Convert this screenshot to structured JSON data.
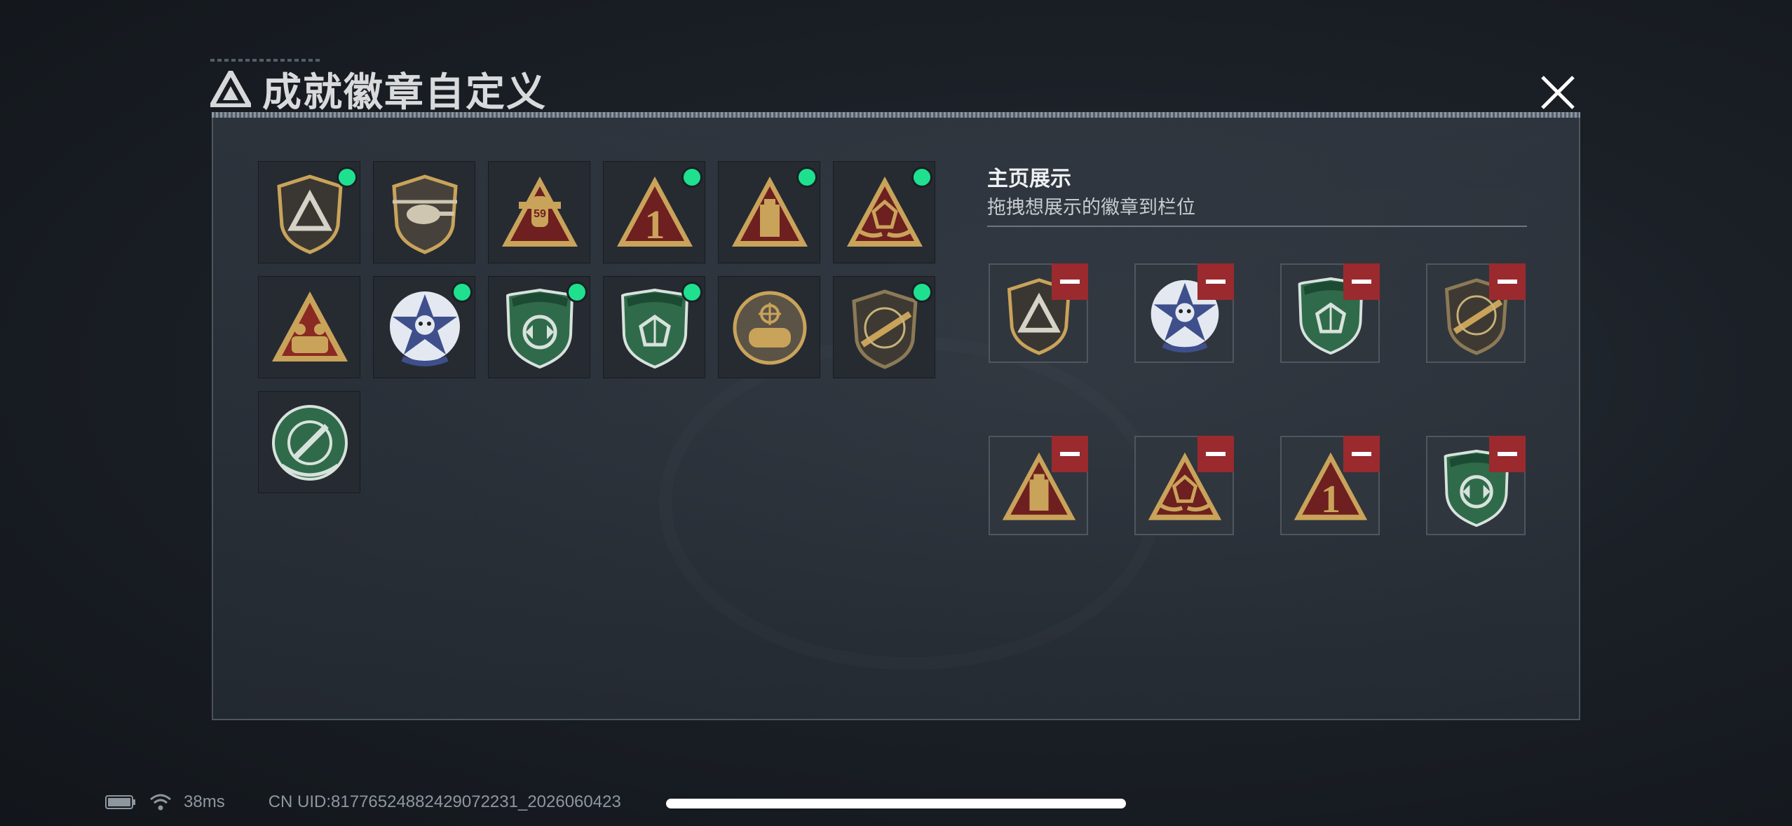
{
  "header": {
    "title": "成就徽章自定义"
  },
  "side": {
    "title": "主页展示",
    "subtitle": "拖拽想展示的徽章到栏位"
  },
  "badges": [
    {
      "icon": "shield-triangle-badge",
      "equipped": true
    },
    {
      "icon": "helicopter-shield-badge",
      "equipped": false
    },
    {
      "icon": "aircraft-59-badge",
      "equipped": false
    },
    {
      "icon": "number-1-triangle-badge",
      "equipped": true
    },
    {
      "icon": "tower-triangle-badge",
      "equipped": true
    },
    {
      "icon": "gem-hands-triangle-badge",
      "equipped": true
    },
    {
      "icon": "squad-triangle-badge",
      "equipped": false
    },
    {
      "icon": "star-skull-badge",
      "equipped": true
    },
    {
      "icon": "green-shield-arrows-badge",
      "equipped": true
    },
    {
      "icon": "green-shield-gem-badge",
      "equipped": true
    },
    {
      "icon": "crosshair-fist-badge",
      "equipped": false
    },
    {
      "icon": "rifle-shield-badge",
      "equipped": true
    },
    {
      "icon": "green-shield-knife-badge",
      "equipped": false
    }
  ],
  "slots": [
    {
      "icon": "shield-triangle-badge"
    },
    {
      "icon": "star-skull-badge"
    },
    {
      "icon": "green-shield-gem-badge"
    },
    {
      "icon": "rifle-shield-badge"
    },
    {
      "icon": "tower-triangle-badge"
    },
    {
      "icon": "gem-hands-triangle-badge"
    },
    {
      "icon": "number-1-triangle-badge"
    },
    {
      "icon": "green-shield-arrows-badge"
    }
  ],
  "status": {
    "latency": "38ms",
    "uid": "CN UID:81776524882429072231_2026060423"
  },
  "colors": {
    "equipped_dot": "#1fe08e",
    "remove": "#9a2a2e",
    "gold": "#c9a35a",
    "green": "#2f6b4a"
  }
}
